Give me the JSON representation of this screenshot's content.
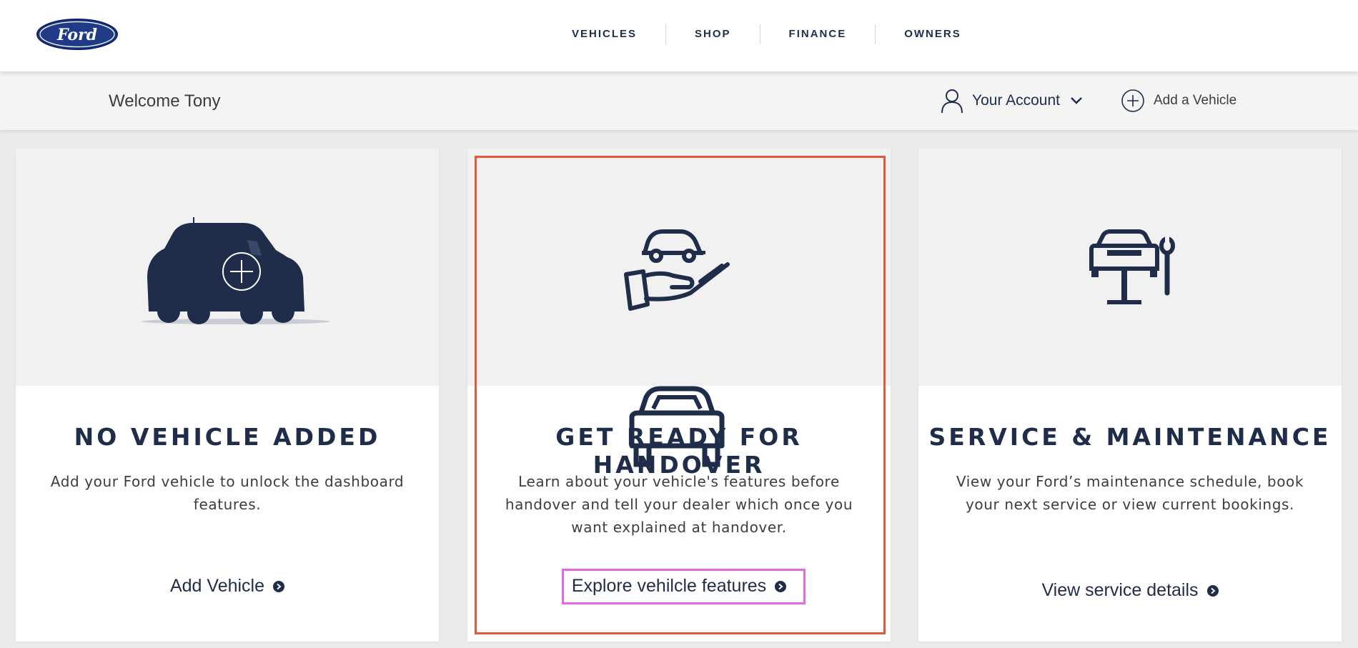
{
  "brand": {
    "logo_text": "Ford",
    "color": "#1f3b87"
  },
  "nav": {
    "items": [
      {
        "label": "VEHICLES"
      },
      {
        "label": "SHOP"
      },
      {
        "label": "FINANCE"
      },
      {
        "label": "OWNERS"
      }
    ]
  },
  "subbar": {
    "welcome": "Welcome Tony",
    "account_label": "Your Account",
    "add_vehicle_label": "Add a Vehicle"
  },
  "cards": [
    {
      "title": "NO VEHICLE ADDED",
      "description": "Add your Ford vehicle to unlock the dashboard features.",
      "link": "Add Vehicle",
      "icon": "suv-silhouette-add-icon"
    },
    {
      "title": "GET READY FOR HANDOVER",
      "description": "Learn about your vehicle's features before handover and tell your dealer which once you want explained at handover.",
      "link": "Explore vehilcle features",
      "icon": "hand-holding-car-icon"
    },
    {
      "title": "SERVICE & MAINTENANCE",
      "description": "View your Ford’s maintenance schedule, book your next service or view current bookings.",
      "link": "View service details",
      "icon": "car-lift-wrench-icon"
    }
  ],
  "colors": {
    "navy": "#1f2d4a",
    "highlight_red": "#e15b3a",
    "highlight_pink": "#e36ae6"
  }
}
